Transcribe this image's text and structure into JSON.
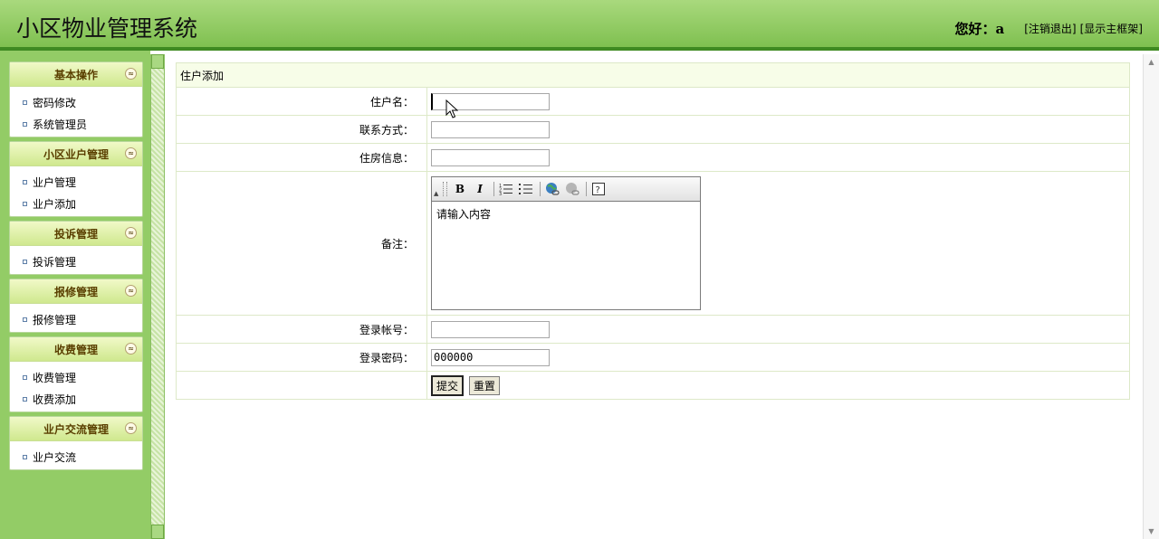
{
  "header": {
    "title": "小区物业管理系统",
    "greeting": "您好：a",
    "logout_label": "[注销退出]",
    "show_frame_label": "[显示主框架]"
  },
  "sidebar": {
    "panels": [
      {
        "title": "基本操作",
        "items": [
          "密码修改",
          "系统管理员"
        ]
      },
      {
        "title": "小区业户管理",
        "items": [
          "业户管理",
          "业户添加"
        ]
      },
      {
        "title": "投诉管理",
        "items": [
          "投诉管理"
        ]
      },
      {
        "title": "报修管理",
        "items": [
          "报修管理"
        ]
      },
      {
        "title": "收费管理",
        "items": [
          "收费管理",
          "收费添加"
        ]
      },
      {
        "title": "业户交流管理",
        "items": [
          "业户交流"
        ]
      }
    ],
    "collapse_glyph": "≈"
  },
  "form": {
    "caption": "住户添加",
    "name_label": "住户名：",
    "name_value": "",
    "contact_label": "联系方式：",
    "contact_value": "",
    "housing_label": "住房信息：",
    "housing_value": "",
    "remark_label": "备注：",
    "remark_content": "请输入内容",
    "account_label": "登录帐号：",
    "account_value": "",
    "password_label": "登录密码：",
    "password_value": "000000",
    "submit_label": "提交",
    "reset_label": "重置"
  },
  "editor_toolbar": {
    "bold": "B",
    "italic": "I"
  },
  "colors": {
    "header_green": "#7fc050",
    "sidebar_green": "#93cc66",
    "header_border": "#3f8a22"
  }
}
